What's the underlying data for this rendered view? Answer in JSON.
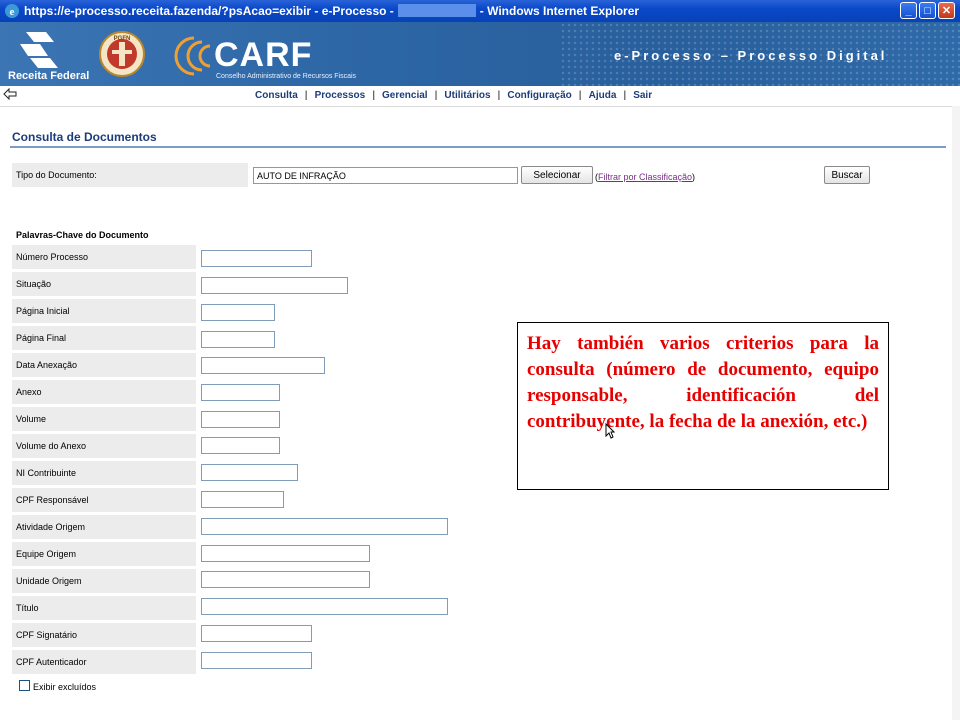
{
  "window": {
    "title_prefix": "https://e-processo.receita.fazenda/?psAcao=exibir - e-Processo -",
    "title_suffix": "- Windows Internet Explorer",
    "min": "_",
    "max": "□",
    "close": "✕"
  },
  "banner": {
    "rf_text": "Receita Federal",
    "pgfn": "PGFN",
    "carf_title": "CARF",
    "carf_sub": "Conselho Administrativo de Recursos Fiscais",
    "eprocesso": "e-Processo – Processo Digital"
  },
  "menu": {
    "items": [
      "Consulta",
      "Processos",
      "Gerencial",
      "Utilitários",
      "Configuração",
      "Ajuda",
      "Sair"
    ]
  },
  "page": {
    "title": "Consulta de Documentos",
    "tipo_label": "Tipo do Documento:",
    "tipo_value": "AUTO DE INFRAÇÃO",
    "selecionar": "Selecionar",
    "filtro_open": "(",
    "filtro_link": "Filtrar por Classificação",
    "filtro_close": ")",
    "buscar": "Buscar",
    "section_header": "Palavras-Chave do Documento",
    "fields": [
      "Número Processo",
      "Situação",
      "Página Inicial",
      "Página Final",
      "Data Anexação",
      "Anexo",
      "Volume",
      "Volume do Anexo",
      "NI Contribuinte",
      "CPF Responsável",
      "Atividade Origem",
      "Equipe Origem",
      "Unidade Origem",
      "Título",
      "CPF Signatário",
      "CPF Autenticador"
    ],
    "checkbox_label": "Exibir excluídos"
  },
  "callout": {
    "text": "Hay también varios criterios para la consulta (número de documento, equipo responsable, identificación del contribuyente, la fecha de la anexión, etc.)"
  },
  "colors": {
    "accent": "#1e3c7a",
    "callout_text": "#e60000",
    "banner": "#2e67a6"
  }
}
